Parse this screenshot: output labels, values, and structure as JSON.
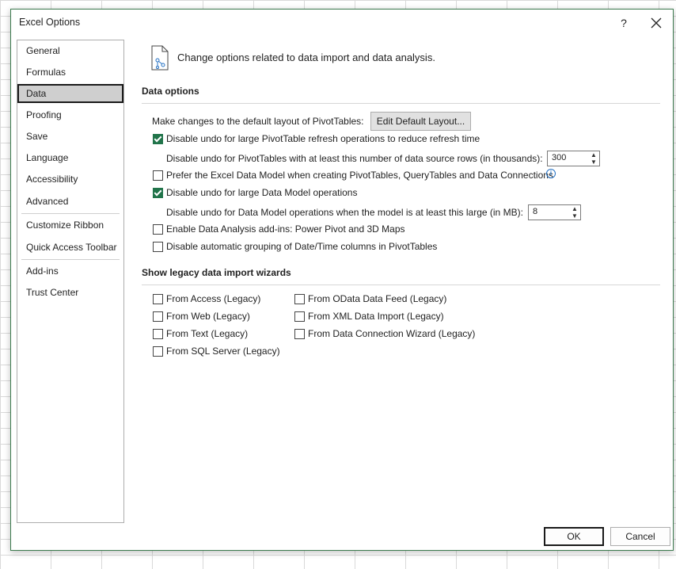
{
  "window": {
    "title": "Excel Options",
    "help": "?",
    "close": "✕"
  },
  "sidebar": {
    "items": [
      {
        "label": "General"
      },
      {
        "label": "Formulas"
      },
      {
        "label": "Data"
      },
      {
        "label": "Proofing"
      },
      {
        "label": "Save"
      },
      {
        "label": "Language"
      },
      {
        "label": "Accessibility"
      },
      {
        "label": "Advanced"
      },
      {
        "label": "Customize Ribbon"
      },
      {
        "label": "Quick Access Toolbar"
      },
      {
        "label": "Add-ins"
      },
      {
        "label": "Trust Center"
      }
    ],
    "selected": "Data"
  },
  "header": {
    "text": "Change options related to data import and data analysis."
  },
  "data_options": {
    "title": "Data options",
    "pivot_layout_label": "Make changes to the default layout of PivotTables:",
    "edit_layout_button": "Edit Default Layout...",
    "undo_pivot_label": "Disable undo for large PivotTable refresh operations to reduce refresh time",
    "undo_pivot_checked": true,
    "undo_pivot_rows_label": "Disable undo for PivotTables with at least this number of data source rows (in thousands):",
    "undo_pivot_rows_value": "300",
    "prefer_model_label": "Prefer the Excel Data Model when creating PivotTables, QueryTables and Data Connections",
    "prefer_model_checked": false,
    "undo_model_label": "Disable undo for large Data Model operations",
    "undo_model_checked": true,
    "undo_model_size_label": "Disable undo for Data Model operations when the model is at least this large (in MB):",
    "undo_model_size_value": "8",
    "addins_label": "Enable Data Analysis add-ins: Power Pivot and 3D Maps",
    "addins_checked": false,
    "grouping_label": "Disable automatic grouping of Date/Time columns in PivotTables",
    "grouping_checked": false
  },
  "legacy": {
    "title": "Show legacy data import wizards",
    "col1": [
      {
        "label": "From Access (Legacy)",
        "checked": false
      },
      {
        "label": "From Web (Legacy)",
        "checked": false
      },
      {
        "label": "From Text (Legacy)",
        "checked": false
      },
      {
        "label": "From SQL Server (Legacy)",
        "checked": false
      }
    ],
    "col2": [
      {
        "label": "From OData Data Feed (Legacy)",
        "checked": false
      },
      {
        "label": "From XML Data Import (Legacy)",
        "checked": false
      },
      {
        "label": "From Data Connection Wizard (Legacy)",
        "checked": false
      }
    ]
  },
  "footer": {
    "ok": "OK",
    "cancel": "Cancel"
  },
  "colors": {
    "accent": "#21744a",
    "frame": "#3c7a4e"
  },
  "icons": {
    "header": "data-document-icon",
    "info": "info-icon"
  }
}
